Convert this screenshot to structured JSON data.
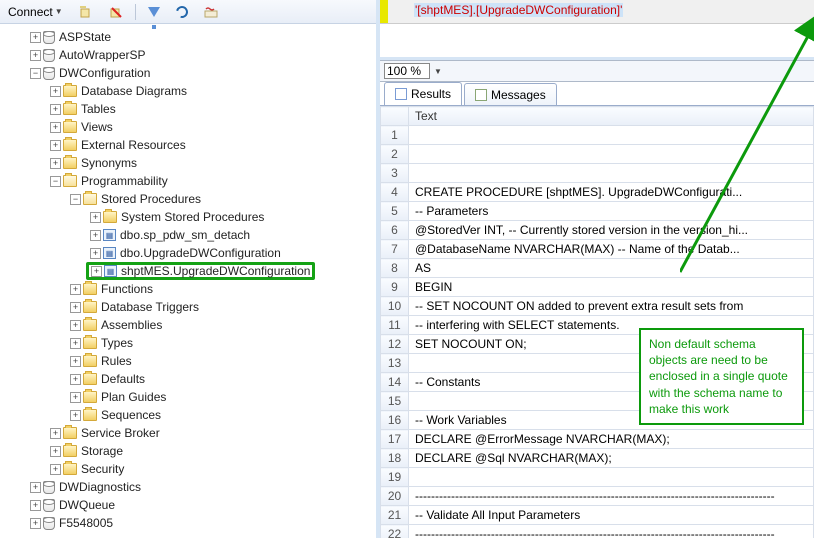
{
  "toolbar": {
    "connect": "Connect"
  },
  "tree": {
    "aspstate": "ASPState",
    "autowrapper": "AutoWrapperSP",
    "dwconfig": "DWConfiguration",
    "dbdiag": "Database Diagrams",
    "tables": "Tables",
    "views": "Views",
    "extres": "External Resources",
    "synonyms": "Synonyms",
    "prog": "Programmability",
    "sprocs": "Stored Procedures",
    "sysprocs": "System Stored Procedures",
    "sp1": "dbo.sp_pdw_sm_detach",
    "sp2": "dbo.UpgradeDWConfiguration",
    "sp3": "shptMES.UpgradeDWConfiguration",
    "funcs": "Functions",
    "dbtrig": "Database Triggers",
    "asm": "Assemblies",
    "types": "Types",
    "rules": "Rules",
    "defaults": "Defaults",
    "planguides": "Plan Guides",
    "seq": "Sequences",
    "sbroker": "Service Broker",
    "storage": "Storage",
    "security": "Security",
    "dwdiag": "DWDiagnostics",
    "dwqueue": "DWQueue",
    "fnum": "F5548005"
  },
  "editor": {
    "q1": "'",
    "b1": "[shptMES]",
    "dot": ".",
    "b2": "[UpgradeDWConfiguration]",
    "q2": "'"
  },
  "zoom": {
    "value": "100 %"
  },
  "tabs": {
    "results": "Results",
    "messages": "Messages"
  },
  "grid_header": "Text",
  "rows": [
    "",
    "",
    "",
    "CREATE PROCEDURE [shptMES]. UpgradeDWConfigurati...",
    "-- Parameters",
    "@StoredVer INT, -- Currently stored version in the version_hi...",
    "@DatabaseName NVARCHAR(MAX) -- Name of the Datab...",
    "AS",
    "BEGIN",
    "-- SET NOCOUNT ON added to prevent extra result sets from",
    "-- interfering with SELECT statements.",
    "SET NOCOUNT ON;",
    "",
    "-- Constants",
    "",
    "-- Work Variables",
    "DECLARE @ErrorMessage NVARCHAR(MAX);",
    "DECLARE @Sql NVARCHAR(MAX);",
    "",
    "------------------------------------------------------------------------------------------",
    "-- Validate All Input Parameters",
    "------------------------------------------------------------------------------------------"
  ],
  "annotation": "Non default schema objects are need to be enclosed in a single quote with the schema name to make this work",
  "chart_data": null
}
